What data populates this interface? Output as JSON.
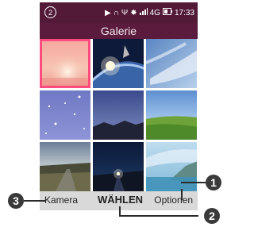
{
  "status_bar": {
    "notification_count": "2",
    "network": "4G",
    "time": "17:33",
    "icons": [
      "notification-circle-icon",
      "play-icon",
      "headphones-icon",
      "usb-icon",
      "bug-icon",
      "signal-icon",
      "battery-icon"
    ]
  },
  "app": {
    "title": "Galerie"
  },
  "softkeys": {
    "left": "Kamera",
    "center": "WÄHLEN",
    "right": "Optionen"
  },
  "callouts": {
    "one": "1",
    "two": "2",
    "three": "3"
  },
  "colors": {
    "status_bar": "#521a37",
    "title_bar": "#5a1b3d",
    "selection_border": "#ff4b7d",
    "softkey_bar": "#d9d9d9"
  }
}
